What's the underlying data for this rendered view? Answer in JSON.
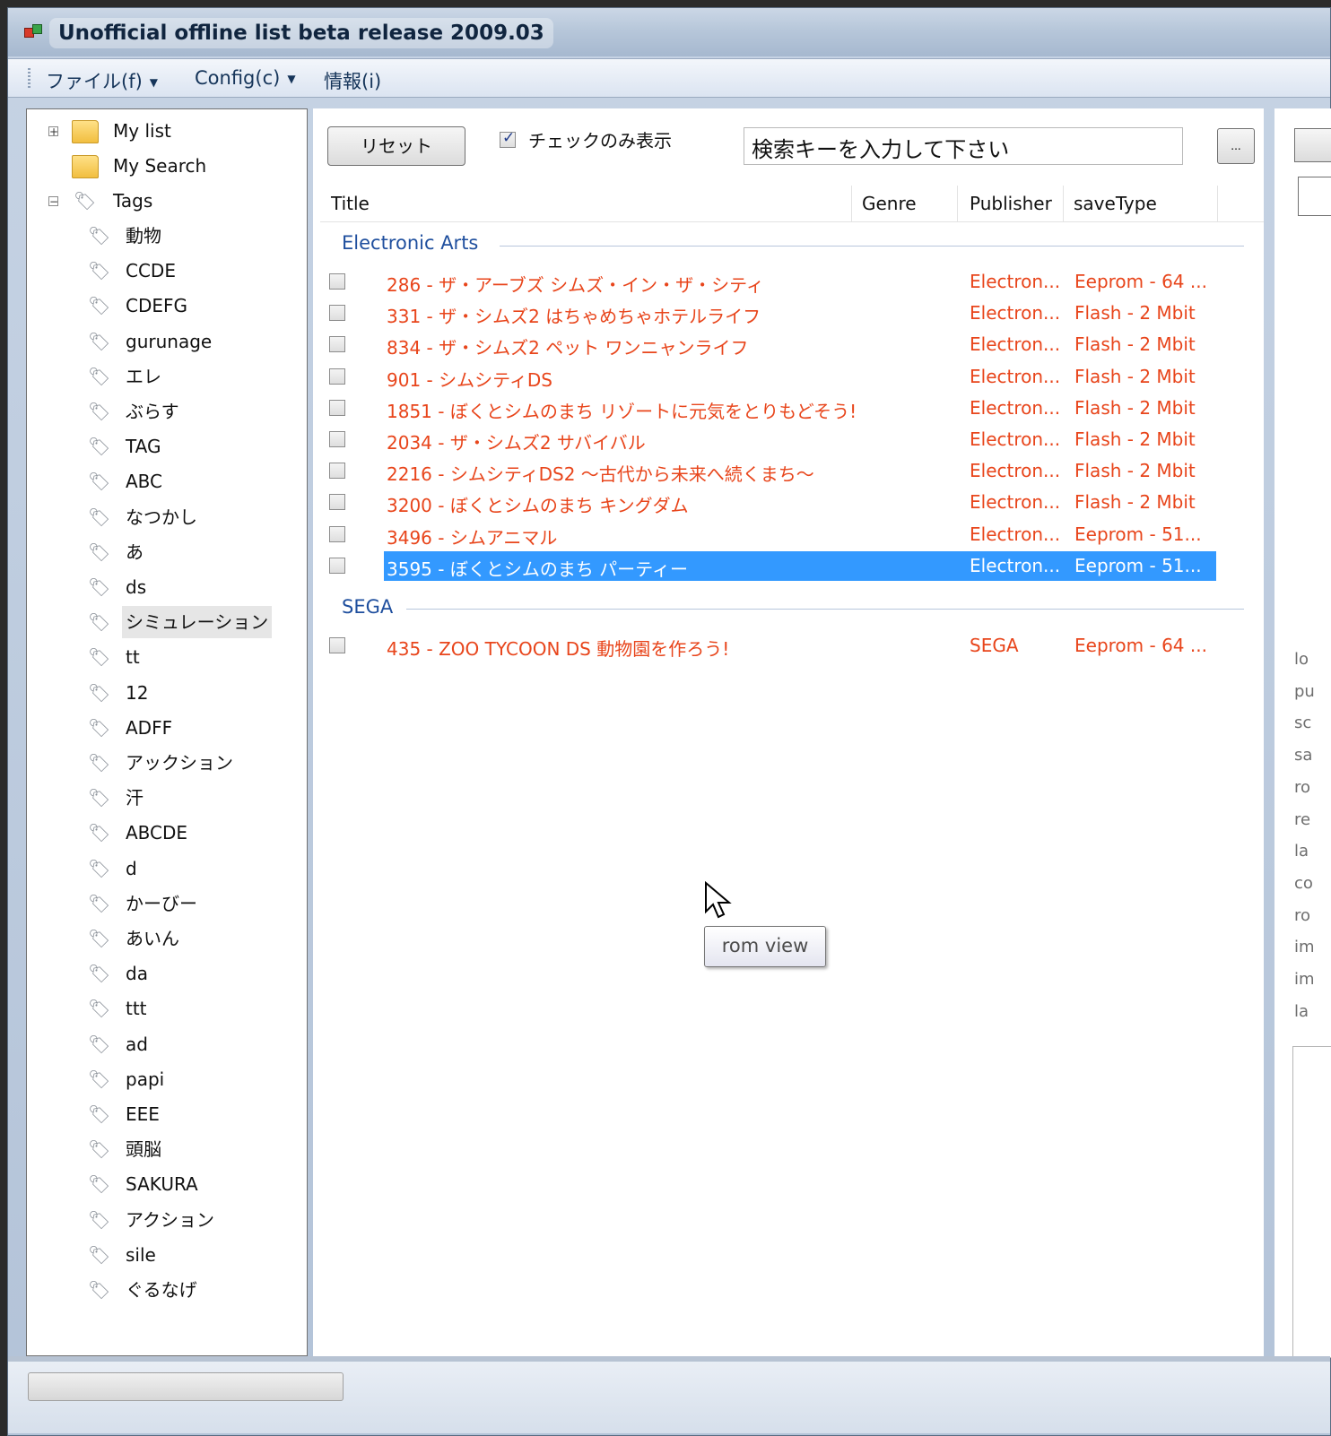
{
  "window": {
    "title": "Unofficial offline list beta release 2009.03"
  },
  "menu": [
    {
      "label": "ファイル(f)"
    },
    {
      "label": "Config(c)"
    },
    {
      "label": "情報(i)"
    }
  ],
  "tree": {
    "my_list": "My list",
    "my_search": "My Search",
    "tags_root": "Tags",
    "tags": [
      "動物",
      "CCDE",
      "CDEFG",
      "gurunage",
      "エレ",
      "ぶらす",
      "TAG",
      "ABC",
      "なつかし",
      "あ",
      "ds",
      "シミュレーション",
      "tt",
      "12",
      "ADFF",
      "アックション",
      "汗",
      "ABCDE",
      "d",
      "かーびー",
      "あいん",
      "da",
      "ttt",
      "ad",
      "papi",
      "EEE",
      "頭脳",
      "SAKURA",
      "アクション",
      "sile",
      "ぐるなげ"
    ],
    "selected_tag": "シミュレーション"
  },
  "toolbar": {
    "reset_label": "リセット",
    "checkonly_label": "チェックのみ表示",
    "search_value": "検索キーを入力して下さい",
    "ellipsis_label": "..."
  },
  "columns": {
    "title": "Title",
    "genre": "Genre",
    "publisher": "Publisher",
    "savetype": "saveType"
  },
  "groups": [
    {
      "name": "Electronic Arts",
      "rows": [
        {
          "title": "286 - ザ・アーブズ シムズ・イン・ザ・シティ",
          "publisher": "Electron...",
          "savetype": "Eeprom - 64 ..."
        },
        {
          "title": "331 - ザ・シムズ2 はちゃめちゃホテルライフ",
          "publisher": "Electron...",
          "savetype": "Flash - 2 Mbit"
        },
        {
          "title": "834 - ザ・シムズ2 ペット ワンニャンライフ",
          "publisher": "Electron...",
          "savetype": "Flash - 2 Mbit"
        },
        {
          "title": "901 - シムシティDS",
          "publisher": "Electron...",
          "savetype": "Flash - 2 Mbit"
        },
        {
          "title": "1851 - ぼくとシムのまち リゾートに元気をとりもどそう!",
          "publisher": "Electron...",
          "savetype": "Flash - 2 Mbit"
        },
        {
          "title": "2034 - ザ・シムズ2 サバイバル",
          "publisher": "Electron...",
          "savetype": "Flash - 2 Mbit"
        },
        {
          "title": "2216 - シムシティDS2 ～古代から未来へ続くまち～",
          "publisher": "Electron...",
          "savetype": "Flash - 2 Mbit"
        },
        {
          "title": "3200 - ぼくとシムのまち キングダム",
          "publisher": "Electron...",
          "savetype": "Flash - 2 Mbit"
        },
        {
          "title": "3496 - シムアニマル",
          "publisher": "Electron...",
          "savetype": "Eeprom - 51..."
        },
        {
          "title": "3595 - ぼくとシムのまち パーティー",
          "publisher": "Electron...",
          "savetype": "Eeprom - 51...",
          "selected": true
        }
      ]
    },
    {
      "name": "SEGA",
      "rows": [
        {
          "title": "435 - ZOO TYCOON DS 動物園を作ろう!",
          "publisher": "SEGA",
          "savetype": "Eeprom - 64 ..."
        }
      ]
    }
  ],
  "tooltip": "rom view",
  "right_panel_labels": [
    "lo",
    "pu",
    "sc",
    "sa",
    "ro",
    "re",
    "la",
    "co",
    "ro",
    "im",
    "im",
    "la"
  ],
  "colors": {
    "row_text": "#e8451b",
    "group_header": "#1f4f9e",
    "selection": "#3399ff"
  }
}
